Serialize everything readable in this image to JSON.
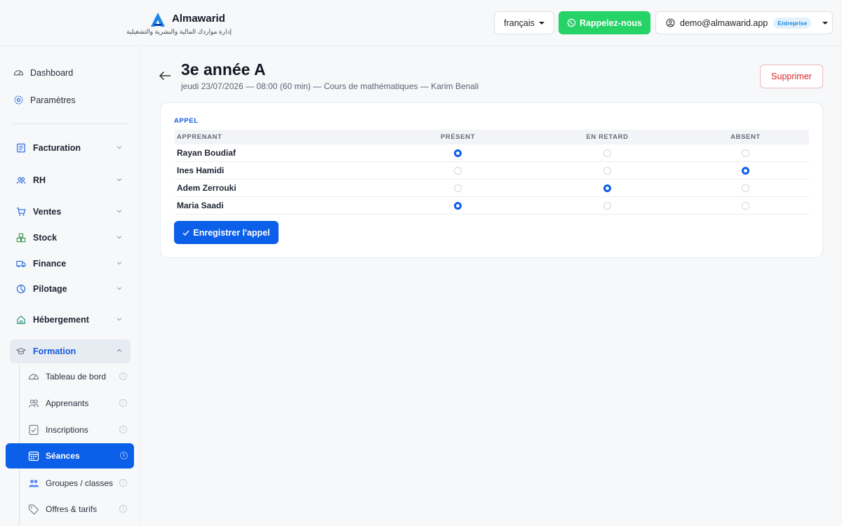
{
  "brand": {
    "name": "Almawarid",
    "tagline": "إدارة مواردك المالية والبشرية والتشغيلية",
    "logo_icon": "almawarid-logo-icon",
    "accent": "#0c5fe8"
  },
  "header": {
    "language": "français",
    "callback_label": "Rappelez-nous",
    "callback_color": "#25d366",
    "user_email": "demo@almawarid.app",
    "plan_badge": "Entreprise"
  },
  "sidebar": {
    "top_links": [
      {
        "label": "Dashboard",
        "icon": "gauge-icon"
      },
      {
        "label": "Paramètres",
        "icon": "gear-icon"
      }
    ],
    "groups": [
      {
        "label": "Facturation",
        "icon": "invoice-icon"
      },
      {
        "label": "RH",
        "icon": "people-icon"
      },
      {
        "label": "Ventes",
        "icon": "cart-icon"
      },
      {
        "label": "Stock",
        "icon": "boxes-icon"
      },
      {
        "label": "Finance",
        "icon": "truck-icon"
      },
      {
        "label": "Pilotage",
        "icon": "pie-chart-icon"
      },
      {
        "label": "Hébergement",
        "icon": "house-icon"
      },
      {
        "label": "Formation",
        "icon": "graduation-cap-icon",
        "expanded": true
      }
    ],
    "formation_items": [
      {
        "label": "Tableau de bord",
        "icon": "gauge-icon"
      },
      {
        "label": "Apprenants",
        "icon": "people-icon"
      },
      {
        "label": "Inscriptions",
        "icon": "checklist-icon"
      },
      {
        "label": "Séances",
        "icon": "calendar-icon",
        "active": true
      },
      {
        "label": "Groupes / classes",
        "icon": "group-icon"
      },
      {
        "label": "Offres & tarifs",
        "icon": "tag-icon"
      }
    ]
  },
  "session": {
    "title": "3e année A",
    "subtitle": "jeudi 23/07/2026 — 08:00 (60 min) — Cours de mathématiques — Karim Benali",
    "delete_label": "Supprimer"
  },
  "attendance": {
    "title": "APPEL",
    "columns": [
      "APPRENANT",
      "PRÉSENT",
      "EN RETARD",
      "ABSENT"
    ],
    "rows": [
      {
        "name": "Rayan Boudiaf",
        "status": "present"
      },
      {
        "name": "Ines Hamidi",
        "status": "absent"
      },
      {
        "name": "Adem Zerrouki",
        "status": "late"
      },
      {
        "name": "Maria Saadi",
        "status": "present"
      }
    ],
    "save_label": "Enregistrer l'appel"
  }
}
